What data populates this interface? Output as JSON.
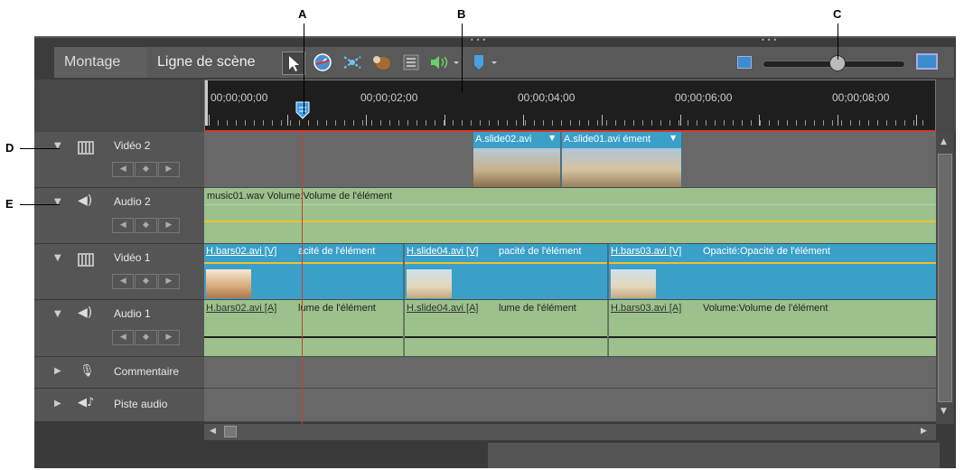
{
  "callouts": {
    "a": "A",
    "b": "B",
    "c": "C",
    "d": "D",
    "e": "E"
  },
  "tabs": {
    "montage": "Montage",
    "ligne_de_scene": "Ligne de scène"
  },
  "ruler": {
    "t0": "00;00;00;00",
    "t1": "00;00;02;00",
    "t2": "00;00;04;00",
    "t3": "00;00;06;00",
    "t4": "00;00;08;00"
  },
  "tracks": {
    "video2": "Vidéo 2",
    "audio2": "Audio 2",
    "video1": "Vidéo 1",
    "audio1": "Audio 1",
    "commentaire": "Commentaire",
    "piste_audio": "Piste audio"
  },
  "clips": {
    "v2a": "A.slide02.avi",
    "v2b": "A.slide01.avi  ément",
    "a2": "music01.wav Volume:Volume de l'élément",
    "v1a_name": "H.bars02.avi [V]",
    "v1a_rest": "acité de l'élément",
    "v1b_name": "H.slide04.avi [V]",
    "v1b_rest": "pacité de l'élément",
    "v1c_name": "H.bars03.avi [V]",
    "v1c_rest": "Opacité:Opacité de l'élément",
    "a1a_name": "H.bars02.avi [A]",
    "a1a_rest": "lume de l'élément",
    "a1b_name": "H.slide04.avi [A]",
    "a1b_rest": "lume de l'élément",
    "a1c_name": "H.bars03.avi [A]",
    "a1c_rest": "Volume:Volume de l'élément"
  },
  "colors": {
    "playhead": "#d23a2a",
    "video_clip": "#3aa0c8",
    "audio_clip": "#9cc18c",
    "opacity_line": "#f0c030"
  }
}
